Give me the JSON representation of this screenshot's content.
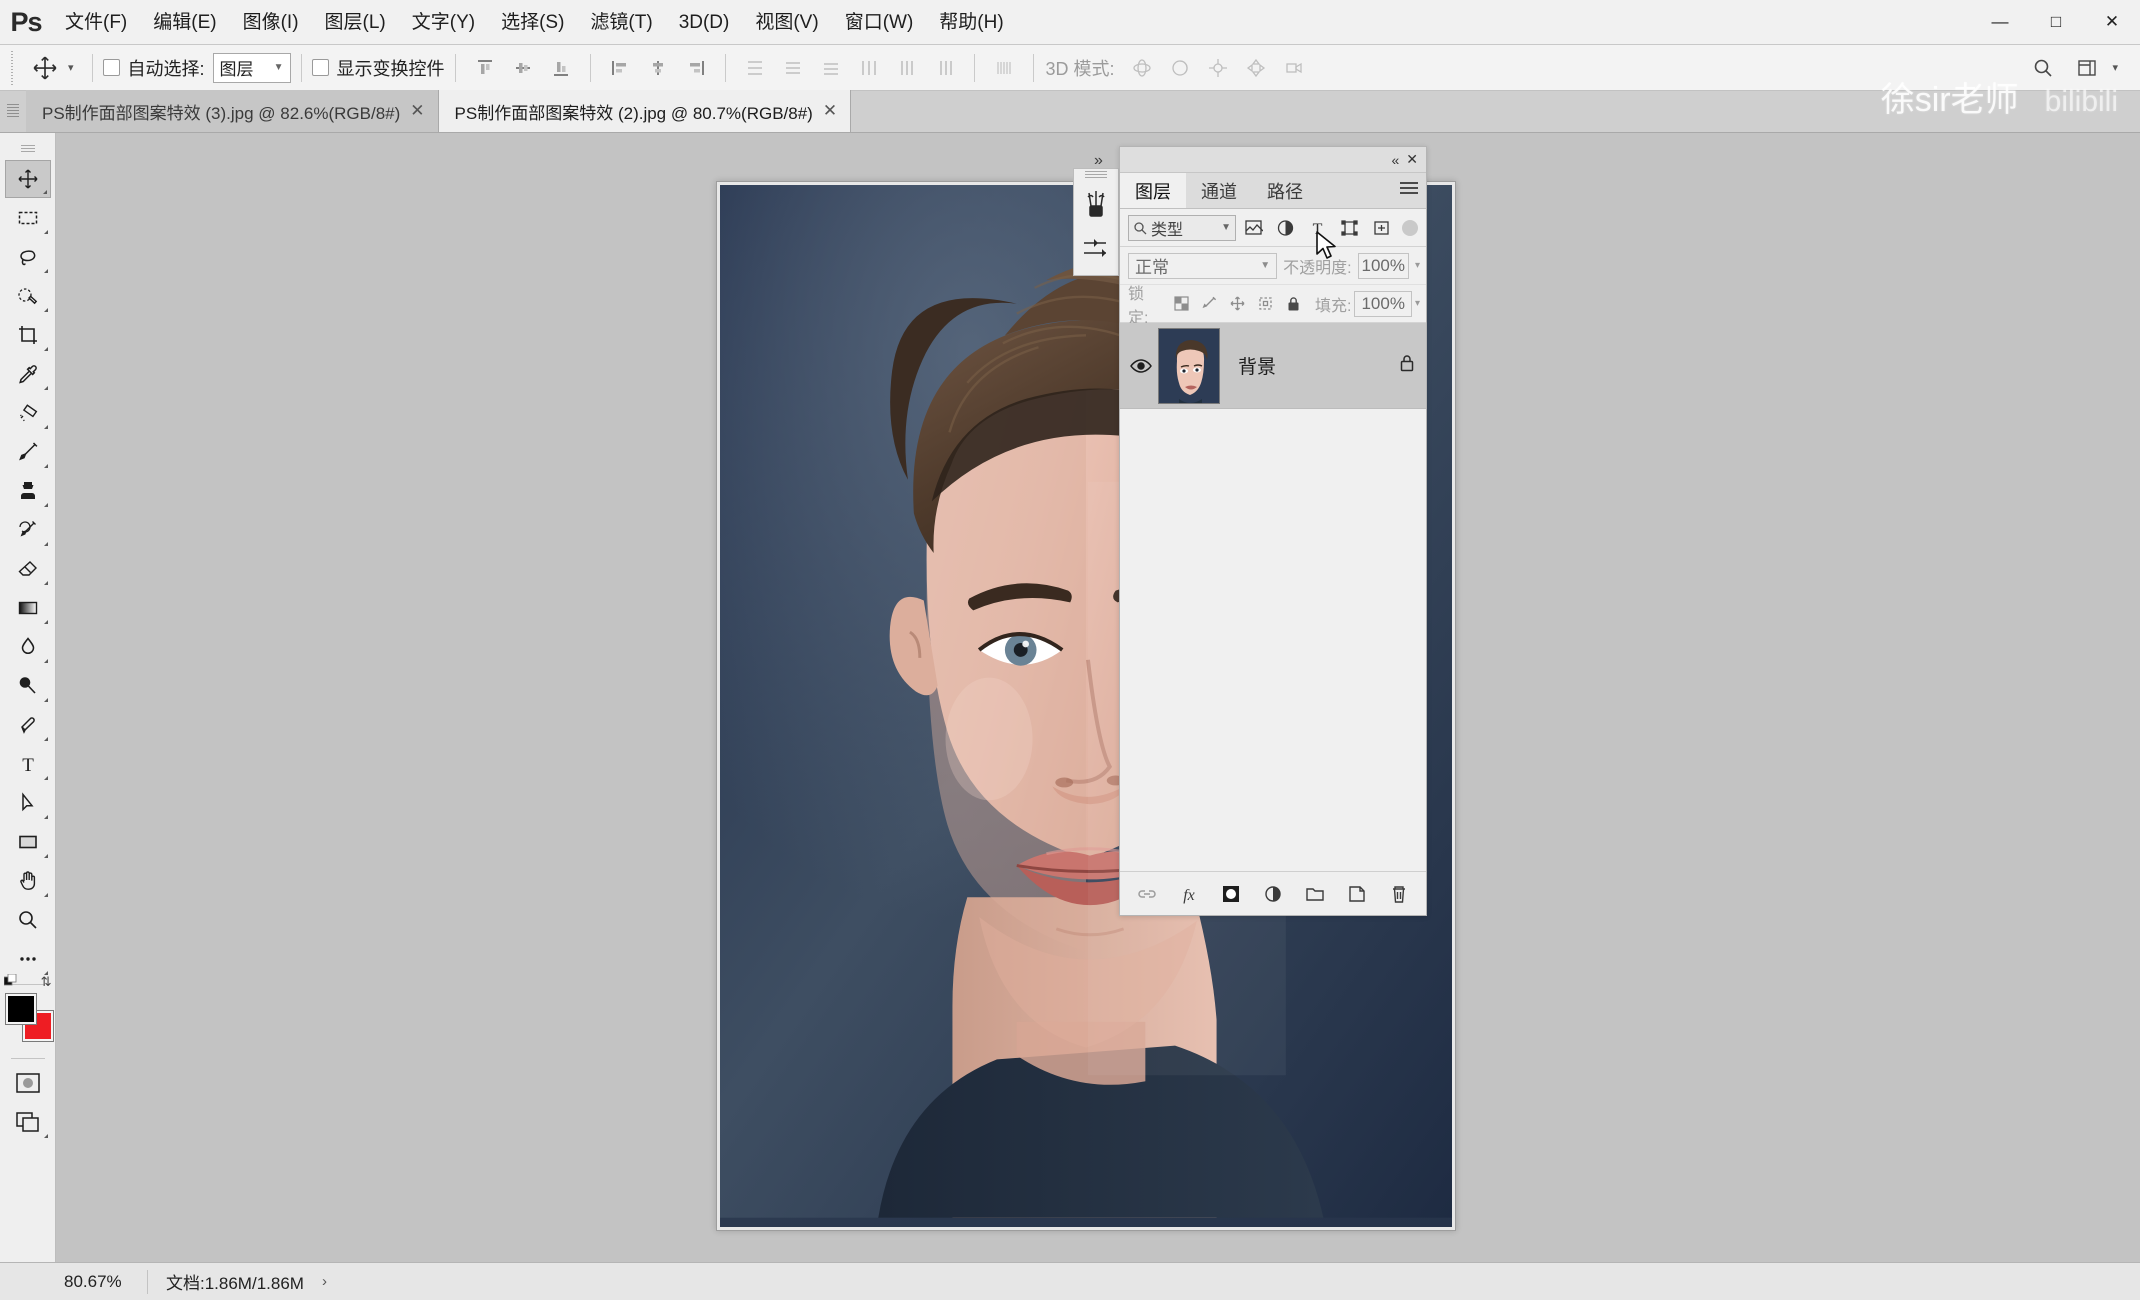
{
  "app": {
    "logo": "Ps",
    "watermark": "徐sir老师",
    "watermark_sub": "bilibili"
  },
  "menubar": {
    "items": [
      {
        "label": "文件(F)",
        "name": "menu-file"
      },
      {
        "label": "编辑(E)",
        "name": "menu-edit"
      },
      {
        "label": "图像(I)",
        "name": "menu-image"
      },
      {
        "label": "图层(L)",
        "name": "menu-layer"
      },
      {
        "label": "文字(Y)",
        "name": "menu-type"
      },
      {
        "label": "选择(S)",
        "name": "menu-select"
      },
      {
        "label": "滤镜(T)",
        "name": "menu-filter"
      },
      {
        "label": "3D(D)",
        "name": "menu-3d"
      },
      {
        "label": "视图(V)",
        "name": "menu-view"
      },
      {
        "label": "窗口(W)",
        "name": "menu-window"
      },
      {
        "label": "帮助(H)",
        "name": "menu-help"
      }
    ],
    "window_controls": {
      "minimize": "—",
      "maximize": "□",
      "close": "✕"
    }
  },
  "optionsbar": {
    "auto_select_label": "自动选择:",
    "auto_select_value": "图层",
    "show_transform_label": "显示变换控件",
    "mode3d_label": "3D 模式:",
    "align_icons": [
      "align-top-edges",
      "align-vertical-centers",
      "align-bottom-edges",
      "align-left-edges",
      "align-horizontal-centers",
      "align-right-edges",
      "distribute-top-edges",
      "distribute-vertical-centers",
      "distribute-bottom-edges",
      "distribute-left-edges",
      "distribute-horizontal-centers",
      "distribute-right-edges",
      "distribute-spacing"
    ],
    "mode3d_icons": [
      "orbit-3d",
      "roll-3d",
      "pan-3d",
      "slide-3d",
      "zoom-3d"
    ],
    "right_icons": [
      "search-icon",
      "workspace-icon",
      "chevron-down-icon"
    ]
  },
  "tabs": [
    {
      "title": "PS制作面部图案特效 (3).jpg @ 82.6%(RGB/8#)",
      "active": false,
      "close": "✕"
    },
    {
      "title": "PS制作面部图案特效 (2).jpg @ 80.7%(RGB/8#)",
      "active": true,
      "close": "✕"
    }
  ],
  "toolbar": {
    "tools": [
      {
        "name": "move-tool",
        "selected": true,
        "flyout": true
      },
      {
        "name": "rectangular-marquee-tool",
        "selected": false,
        "flyout": true
      },
      {
        "name": "lasso-tool",
        "selected": false,
        "flyout": true
      },
      {
        "name": "quick-selection-tool",
        "selected": false,
        "flyout": true
      },
      {
        "name": "crop-tool",
        "selected": false,
        "flyout": true
      },
      {
        "name": "eyedropper-tool",
        "selected": false,
        "flyout": true
      },
      {
        "name": "spot-healing-brush-tool",
        "selected": false,
        "flyout": true
      },
      {
        "name": "brush-tool",
        "selected": false,
        "flyout": true
      },
      {
        "name": "clone-stamp-tool",
        "selected": false,
        "flyout": true
      },
      {
        "name": "history-brush-tool",
        "selected": false,
        "flyout": true
      },
      {
        "name": "eraser-tool",
        "selected": false,
        "flyout": true
      },
      {
        "name": "gradient-tool",
        "selected": false,
        "flyout": true
      },
      {
        "name": "blur-tool",
        "selected": false,
        "flyout": true
      },
      {
        "name": "dodge-tool",
        "selected": false,
        "flyout": true
      },
      {
        "name": "pen-tool",
        "selected": false,
        "flyout": true
      },
      {
        "name": "horizontal-type-tool",
        "selected": false,
        "flyout": true
      },
      {
        "name": "path-selection-tool",
        "selected": false,
        "flyout": true
      },
      {
        "name": "rectangle-tool",
        "selected": false,
        "flyout": true
      },
      {
        "name": "hand-tool",
        "selected": false,
        "flyout": true
      },
      {
        "name": "zoom-tool",
        "selected": false,
        "flyout": false
      },
      {
        "name": "edit-toolbar-tool",
        "selected": false,
        "flyout": true
      }
    ],
    "foreground_color": "#000000",
    "background_color": "#ee1d23",
    "quick_mask_name": "quick-mask-mode",
    "screen_mode_name": "screen-mode"
  },
  "layers_panel": {
    "titlebar": {
      "collapse": "«",
      "close": "✕"
    },
    "tabs": [
      {
        "label": "图层",
        "active": true,
        "name": "tab-layers"
      },
      {
        "label": "通道",
        "active": false,
        "name": "tab-channels"
      },
      {
        "label": "路径",
        "active": false,
        "name": "tab-paths"
      }
    ],
    "filter": {
      "kind_value": "类型",
      "icons": [
        "filter-pixel-icon",
        "filter-adjustment-icon",
        "filter-type-icon",
        "filter-shape-icon",
        "filter-smart-object-icon"
      ]
    },
    "blend_mode": "正常",
    "opacity_label": "不透明度:",
    "opacity_value": "100%",
    "lock_label": "锁定:",
    "lock_icons": [
      "lock-transparent-pixels-icon",
      "lock-image-pixels-icon",
      "lock-position-icon",
      "lock-artboard-icon",
      "lock-all-icon"
    ],
    "fill_label": "填充:",
    "fill_value": "100%",
    "layers": [
      {
        "name": "背景",
        "visible": true,
        "locked": true,
        "selected": true
      }
    ],
    "bottom_buttons": [
      {
        "name": "link-layers-button",
        "glyph": "link"
      },
      {
        "name": "layer-style-fx-button",
        "glyph": "fx"
      },
      {
        "name": "add-layer-mask-button",
        "glyph": "mask"
      },
      {
        "name": "new-adjustment-layer-button",
        "glyph": "adjustment"
      },
      {
        "name": "new-group-button",
        "glyph": "folder"
      },
      {
        "name": "new-layer-button",
        "glyph": "newlayer"
      },
      {
        "name": "delete-layer-button",
        "glyph": "trash"
      }
    ]
  },
  "statusbar": {
    "zoom": "80.67%",
    "doc_info": "文档:1.86M/1.86M",
    "arrow": "›"
  }
}
